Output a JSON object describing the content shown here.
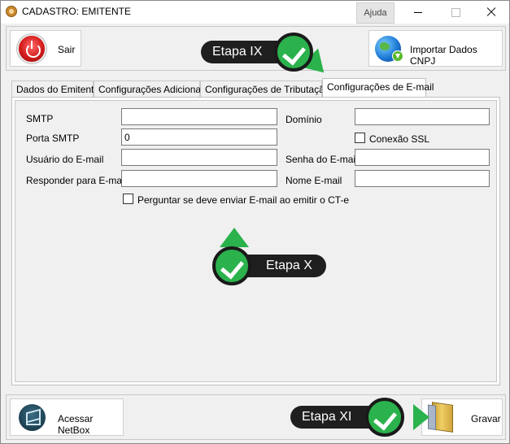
{
  "window": {
    "title": "CADASTRO: EMITENTE",
    "help_label": "Ajuda"
  },
  "toolbar": {
    "exit_label": "Sair",
    "import_label": "Importar Dados CNPJ"
  },
  "tabs": [
    {
      "label": "Dados do Emitente",
      "active": false
    },
    {
      "label": "Configurações Adicionais",
      "active": false
    },
    {
      "label": "Configurações de Tributação",
      "active": false
    },
    {
      "label": "Configurações de E-mail",
      "active": true
    }
  ],
  "email_form": {
    "smtp_label": "SMTP",
    "smtp_value": "",
    "port_label": "Porta SMTP",
    "port_value": "0",
    "user_label": "Usuário do E-mail",
    "user_value": "",
    "reply_label": "Responder para E-mail",
    "reply_value": "",
    "domain_label": "Domínio",
    "domain_value": "",
    "ssl_label": "Conexão SSL",
    "ssl_checked": false,
    "password_label": "Senha do E-mail",
    "password_value": "",
    "name_label": "Nome E-mail",
    "name_value": "",
    "ask_label": "Perguntar se deve enviar E-mail ao emitir o CT-e",
    "ask_checked": false
  },
  "footer": {
    "netbox_label": "Acessar NetBox",
    "save_label": "Gravar"
  },
  "steps": {
    "step9": "Etapa IX",
    "step10": "Etapa X",
    "step11": "Etapa XI"
  },
  "colors": {
    "callout_bg": "#1f1f1f",
    "check_green": "#2bb24c",
    "window_bg": "#f0f0f0"
  }
}
